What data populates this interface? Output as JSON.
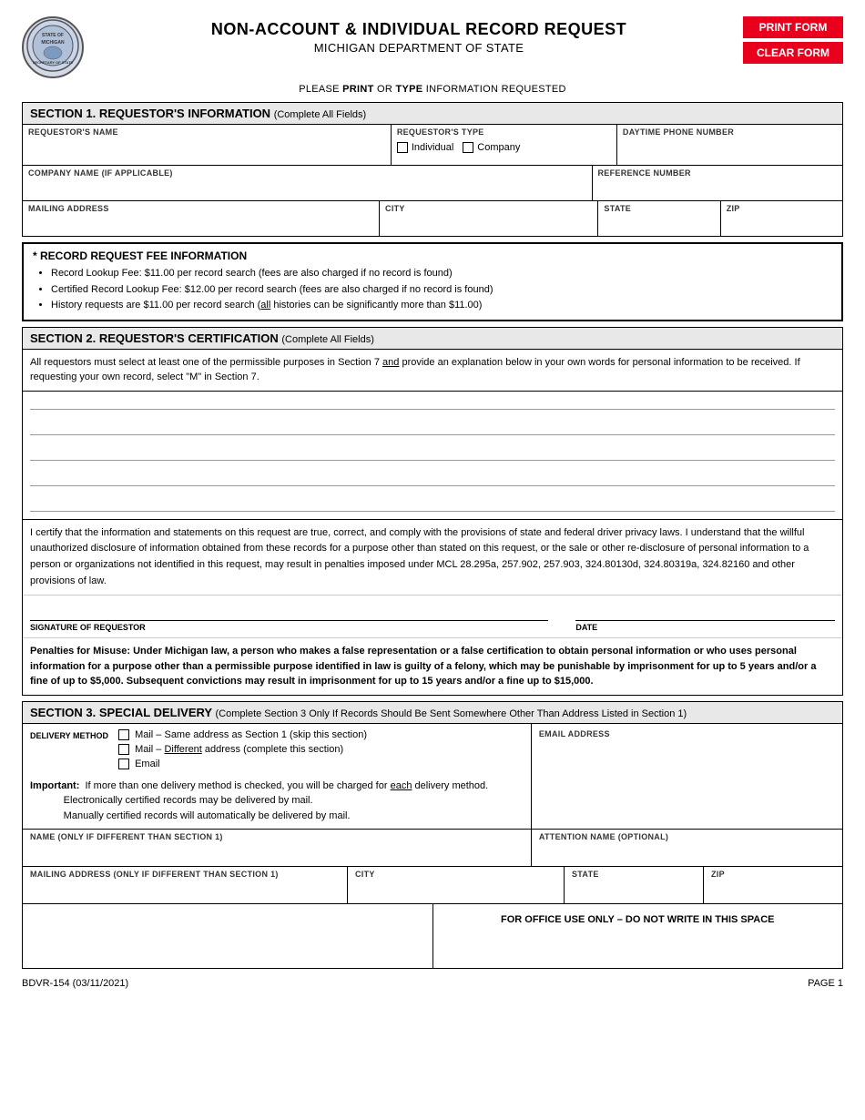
{
  "header": {
    "title": "NON-ACCOUNT & INDIVIDUAL RECORD REQUEST",
    "subtitle": "MICHIGAN DEPARTMENT OF STATE",
    "instruction": "PLEASE PRINT OR TYPE INFORMATION REQUESTED",
    "print_btn": "PRINT FORM",
    "clear_btn": "CLEAR FORM"
  },
  "section1": {
    "heading": "SECTION 1. REQUESTOR'S INFORMATION",
    "heading_sub": "(Complete All Fields)",
    "requestor_name_label": "REQUESTOR'S NAME",
    "requestor_type_label": "REQUESTOR'S TYPE",
    "type_individual": "Individual",
    "type_company": "Company",
    "daytime_phone_label": "DAYTIME PHONE NUMBER",
    "company_name_label": "COMPANY NAME (IF APPLICABLE)",
    "reference_number_label": "REFERENCE NUMBER",
    "mailing_address_label": "MAILING ADDRESS",
    "city_label": "CITY",
    "state_label": "STATE",
    "zip_label": "ZIP"
  },
  "fee_info": {
    "title": "* RECORD REQUEST FEE INFORMATION",
    "items": [
      "Record Lookup Fee: $11.00 per record search (fees are also charged if no record is found)",
      "Certified Record Lookup Fee: $12.00 per record search (fees are also charged if no record is found)",
      "History requests are $11.00 per record search (all histories can be significantly more than $11.00)"
    ]
  },
  "section2": {
    "heading": "SECTION 2. REQUESTOR'S CERTIFICATION",
    "heading_sub": "(Complete All Fields)",
    "description": "All requestors must select at least one of the permissible purposes in Section 7 and provide an explanation below in your own words for personal information to be received. If requesting your own record, select \"M\" in Section 7.",
    "certify_text": "I certify that the information and statements on this request are true, correct, and comply with the provisions of state and federal driver privacy laws. I understand that the willful unauthorized disclosure of information obtained from these records for a purpose other than stated on this request, or the sale or other re-disclosure of personal information to a person or organizations not identified in this request, may result in penalties imposed under MCL 28.295a, 257.902, 257.903, 324.80130d, 324.80319a, 324.82160 and other provisions of law.",
    "signature_label": "SIGNATURE OF REQUESTOR",
    "date_label": "DATE",
    "penalty_text": "Penalties for Misuse: Under Michigan law, a person who makes a false representation or a false certification to obtain personal information or who uses personal information for a purpose other than a permissible purpose identified in law is guilty of a felony, which may be punishable by imprisonment for up to 5 years and/or a fine of up to $5,000. Subsequent convictions may result in imprisonment for up to 15 years and/or a fine up to $15,000."
  },
  "section3": {
    "heading": "SECTION 3. SPECIAL DELIVERY",
    "heading_sub": "(Complete Section 3 Only If Records Should Be Sent Somewhere Other Than Address Listed in Section 1)",
    "delivery_method_label": "DELIVERY METHOD",
    "option_mail_same": "Mail – Same address as Section 1 (skip this section)",
    "option_mail_diff": "Mail – Different address (complete this section)",
    "option_email": "Email",
    "important_label": "Important:",
    "important_text": "If more than one delivery method is checked, you will be charged for each delivery method.\nElectronically certified records may be delivered by mail.\nManually certified records will automatically be delivered by mail.",
    "email_address_label": "EMAIL ADDRESS",
    "name_label": "NAME (ONLY IF DIFFERENT THAN SECTION 1)",
    "attention_label": "ATTENTION NAME (OPTIONAL)",
    "mailing_address_label": "MAILING ADDRESS (ONLY IF DIFFERENT THAN SECTION 1)",
    "city_label": "CITY",
    "state_label": "STATE",
    "zip_label": "ZIP",
    "office_use_text": "FOR OFFICE USE ONLY – DO NOT WRITE IN THIS SPACE"
  },
  "footer": {
    "form_number": "BDVR-154 (03/11/2021)",
    "page": "PAGE 1"
  }
}
